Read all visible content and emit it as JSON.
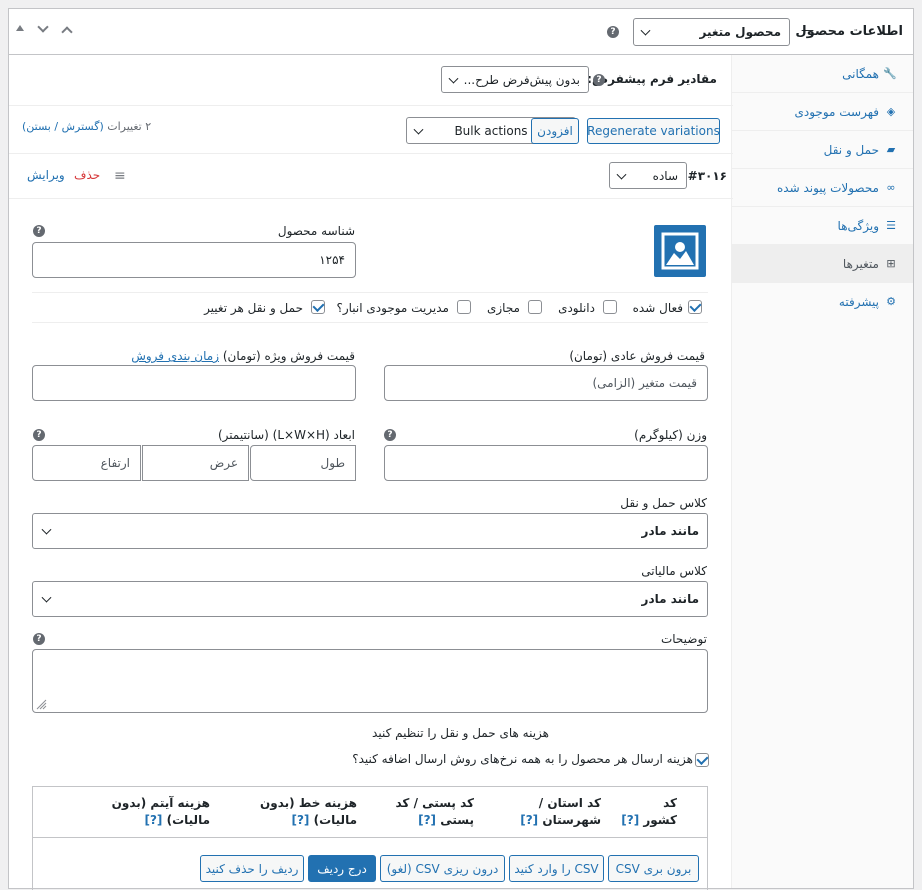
{
  "header": {
    "title": "اطلاعات محصول",
    "dash": "—",
    "product_type": "محصول متغیر",
    "help": "?"
  },
  "tabs": [
    {
      "label": "همگانی",
      "icon": "wrench-icon",
      "glyph": "🔧"
    },
    {
      "label": "فهرست موجودی",
      "icon": "tag-icon",
      "glyph": "◈"
    },
    {
      "label": "حمل و نقل",
      "icon": "truck-icon",
      "glyph": "▰"
    },
    {
      "label": "محصولات پیوند شده",
      "icon": "link-icon",
      "glyph": "∞"
    },
    {
      "label": "ویژگی‌ها",
      "icon": "list-icon",
      "glyph": "☰"
    },
    {
      "label": "متغیرها",
      "icon": "grid-icon",
      "glyph": "⊞"
    },
    {
      "label": "پیشرفته",
      "icon": "gear-icon",
      "glyph": "⚙"
    }
  ],
  "defaults": {
    "label": "مقادیر فرم پیشفرض:",
    "value": "بدون پیش‌فرض طرح..."
  },
  "toolbar": {
    "bulk_actions": "Bulk actions",
    "add": "افزودن",
    "regenerate": "Regenerate variations",
    "count": "۲ تغییرات",
    "expand_open": "(",
    "expand": "گسترش",
    "sep": " / ",
    "close": "بستن",
    "expand_close": ")"
  },
  "variation": {
    "id": "#۳۰۱۶",
    "attribute": "ساده",
    "delete": "حذف",
    "edit": "ویرایش",
    "drag": "≡"
  },
  "form": {
    "sku_label": "شناسه محصول",
    "sku_value": "۱۲۵۴",
    "enabled": "فعال شده",
    "downloadable": "دانلودی",
    "virtual": "مجازی",
    "manage_stock": "مدیریت موجودی انبار؟",
    "shipping_each": "حمل و نقل هر تغییر",
    "regular_price_label": "قیمت فروش عادی (تومان)",
    "regular_price_placeholder": "قیمت متغیر (الزامی)",
    "sale_price_label": "قیمت فروش ویژه (تومان)",
    "sale_schedule": "زمان بندی فروش",
    "weight_label": "وزن (کیلوگرم)",
    "dims_label": "ابعاد (L×W×H) (سانتیمتر)",
    "length_ph": "طول",
    "width_ph": "عرض",
    "height_ph": "ارتفاع",
    "shipping_class_label": "کلاس حمل و نقل",
    "shipping_class_value": "مانند مادر",
    "tax_class_label": "کلاس مالیاتی",
    "tax_class_value": "مانند مادر",
    "desc_label": "توضیحات",
    "shipping_costs_title": "هزینه های حمل و نقل را تنظیم کنید",
    "shipping_costs_check": "هزینه ارسال هر محصول را به همه نرخ‌های روش ارسال اضافه کنید؟"
  },
  "rates_table": {
    "headers": [
      {
        "line1": "کد",
        "line2": "کشور",
        "help": "[?]"
      },
      {
        "line1": "کد استان /",
        "line2": "شهرستان",
        "help": "[?]"
      },
      {
        "line1": "کد پستی / کد",
        "line2": "پستی",
        "help": "[?]"
      },
      {
        "line1": "هزینه خط (بدون",
        "line2": "مالیات)",
        "help": "[?]"
      },
      {
        "line1": "هزینه آیتم (بدون",
        "line2": "مالیات)",
        "help": "[?]"
      }
    ],
    "buttons": {
      "export_csv": "برون بری CSV",
      "import_csv": "CSV را وارد کنید",
      "import_cancel": "درون ریزی CSV (لغو)",
      "insert_row": "درج ردیف",
      "delete_rows": "ردیف را حذف کنید"
    }
  },
  "colors": {
    "accent": "#2271b1",
    "danger": "#d63638",
    "border": "#c3c4c7"
  }
}
